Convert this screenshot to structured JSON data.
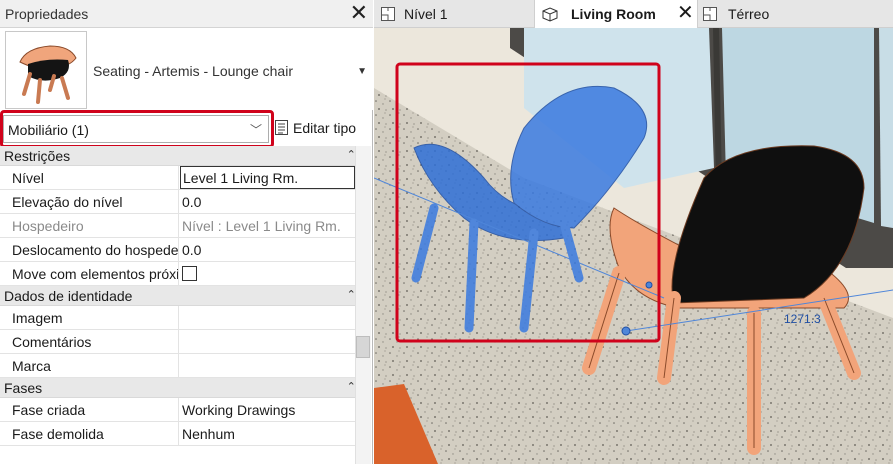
{
  "properties": {
    "title": "Propriedades",
    "type_selector": {
      "name": "Seating - Artemis - Lounge chair"
    },
    "filter": {
      "value": "Mobiliário (1)"
    },
    "edit_type_label": "Editar tipo",
    "groups": [
      {
        "label": "Restrições",
        "rows": [
          {
            "key": "Nível",
            "value": "Level 1 Living Rm."
          },
          {
            "key": "Elevação do nível",
            "value": "0.0"
          },
          {
            "key": "Hospedeiro",
            "value": "Nível : Level 1 Living Rm."
          },
          {
            "key": "Deslocamento do hospedeiro",
            "value": "0.0"
          },
          {
            "key": "Move com elementos próximos",
            "checked": false
          }
        ]
      },
      {
        "label": "Dados de identidade",
        "rows": [
          {
            "key": "Imagem",
            "value": ""
          },
          {
            "key": "Comentários",
            "value": ""
          },
          {
            "key": "Marca",
            "value": ""
          }
        ]
      },
      {
        "label": "Fases",
        "rows": [
          {
            "key": "Fase criada",
            "value": "Working Drawings"
          },
          {
            "key": "Fase demolida",
            "value": "Nenhum"
          }
        ]
      }
    ]
  },
  "tabs": [
    {
      "label": "Nível 1",
      "icon": "floor-plan-icon",
      "active": false
    },
    {
      "label": "Living Room",
      "icon": "3d-view-icon",
      "active": true
    },
    {
      "label": "Térreo",
      "icon": "floor-plan-icon",
      "active": false
    }
  ],
  "viewport": {
    "dimension_label": "1271.3"
  },
  "colors": {
    "highlight": "#d0021b",
    "selected_chair": "#2f6fd6",
    "chair_shell": "#f2a47a",
    "chair_cushion": "#0f0f0f",
    "floor": "#d3cec2",
    "wall": "#ece7dc",
    "rug": "#d9622b"
  }
}
